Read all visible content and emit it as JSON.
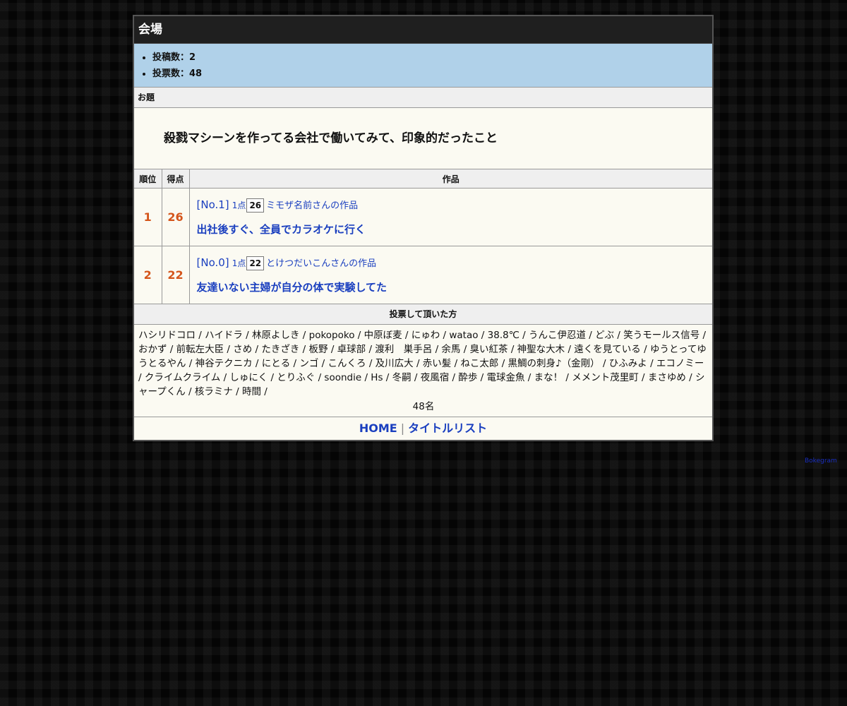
{
  "page": {
    "title": "会場"
  },
  "stats": {
    "posts": "投稿数：2",
    "votes": "投票数：48"
  },
  "theme": {
    "label": "お題",
    "text": "殺戮マシーンを作ってる会社で働いてみて、印象的だったこと"
  },
  "ranking": {
    "headers": {
      "rank": "順位",
      "score": "得点",
      "work": "作品"
    },
    "rows": [
      {
        "rank": "1",
        "score": "26",
        "no": "[No.1]",
        "pt": "1点",
        "box": "26",
        "author": "ミモザ名前さんの作品",
        "title": "出社後すぐ、全員でカラオケに行く"
      },
      {
        "rank": "2",
        "score": "22",
        "no": "[No.0]",
        "pt": "1点",
        "box": "22",
        "author": "とけつだいこんさんの作品",
        "title": "友達いない主婦が自分の体で実験してた"
      }
    ]
  },
  "voters": {
    "header": "投票して頂いた方",
    "list": "ハシリドコロ / ハイドラ / 林原よしき / pokopoko / 中原ぼ麦 / にゅわ / watao / 38.8℃ / うんこ伊忍道 / どぶ / 笑うモールス信号 / おかず / 前転左大臣 / さめ / たきざき / 板野 / 卓球部 / 渡利　巣手呂 / 余馬 / 臭い紅茶 / 神聖な大木 / 遠くを見ている / ゆうとってゆうとるやん / 神谷テクニカ / にとる / ンゴ / こんくろ / 及川広大 / 赤い髪 / ねこ太郎 / 黒鯛の刺身♪（金剛） / ひふみよ / エコノミー / クライムクライム / しゅにく / とりふぐ / soondie / Hs / 冬嗣 / 夜風宿 / 酔歩 / 電球金魚 / まな！ / メメント茂里町 / まさゆめ / シャープくん / 核ラミナ / 時間 /",
    "count": "48名"
  },
  "footer": {
    "home": "HOME",
    "separator": "|",
    "titles": "タイトルリスト"
  },
  "corner": {
    "label": "Bokegram"
  }
}
